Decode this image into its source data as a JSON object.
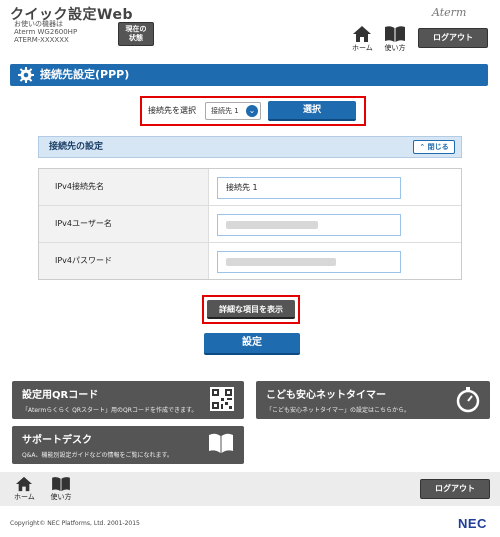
{
  "header": {
    "title": "クイック設定Web",
    "device_label": "お使いの機器は",
    "model": "Aterm WG2600HP",
    "device_id": "ATERM-XXXXXX",
    "status_button": [
      "現在の",
      "状態"
    ],
    "brand": "Aterm",
    "home_label": "ホーム",
    "help_label": "使い方",
    "logout_label": "ログアウト"
  },
  "page": {
    "title": "接続先設定(PPP)",
    "select_label": "接続先を選択",
    "select_value": "接続先 1",
    "select_button": "選択"
  },
  "section": {
    "title": "接続先の設定",
    "close_button": "閉じる",
    "rows": [
      {
        "label": "IPv4接続先名",
        "value": "接続先 1"
      },
      {
        "label": "IPv4ユーザー名",
        "value": ""
      },
      {
        "label": "IPv4パスワード",
        "value": ""
      }
    ]
  },
  "actions": {
    "details_button": "詳細な項目を表示",
    "save_button": "設定"
  },
  "tiles": {
    "qr": {
      "title": "設定用QRコード",
      "desc": "「Atermらくらく QRスタート」用のQRコードを作成できます。"
    },
    "timer": {
      "title": "こども安心ネットタイマー",
      "desc": "「こども安心ネットタイマー」の設定はこちらから。"
    },
    "support": {
      "title": "サポートデスク",
      "desc": "Q&A、機能別設定ガイドなどの情報をご覧になれます。"
    }
  },
  "footer": {
    "home_label": "ホーム",
    "help_label": "使い方",
    "logout_label": "ログアウト",
    "copyright": "Copyright© NEC Platforms, Ltd. 2001-2015",
    "logo": "NEC"
  }
}
